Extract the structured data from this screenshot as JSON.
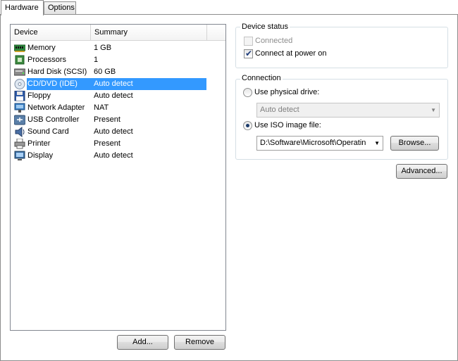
{
  "tabs": [
    {
      "label": "Hardware",
      "active": true
    },
    {
      "label": "Options",
      "active": false
    }
  ],
  "device_list": {
    "columns": {
      "device": "Device",
      "summary": "Summary"
    },
    "rows": [
      {
        "device": "Memory",
        "summary": "1 GB",
        "icon": "memory-icon"
      },
      {
        "device": "Processors",
        "summary": "1",
        "icon": "processor-icon"
      },
      {
        "device": "Hard Disk (SCSI)",
        "summary": "60 GB",
        "icon": "hard-disk-icon"
      },
      {
        "device": "CD/DVD (IDE)",
        "summary": "Auto detect",
        "icon": "cd-dvd-icon",
        "selected": true
      },
      {
        "device": "Floppy",
        "summary": "Auto detect",
        "icon": "floppy-icon"
      },
      {
        "device": "Network Adapter",
        "summary": "NAT",
        "icon": "network-adapter-icon"
      },
      {
        "device": "USB Controller",
        "summary": "Present",
        "icon": "usb-icon"
      },
      {
        "device": "Sound Card",
        "summary": "Auto detect",
        "icon": "sound-card-icon"
      },
      {
        "device": "Printer",
        "summary": "Present",
        "icon": "printer-icon"
      },
      {
        "device": "Display",
        "summary": "Auto detect",
        "icon": "display-icon"
      }
    ]
  },
  "buttons": {
    "add": "Add...",
    "remove": "Remove",
    "browse": "Browse...",
    "advanced": "Advanced..."
  },
  "device_status": {
    "title": "Device status",
    "connected": {
      "label": "Connected",
      "checked": false,
      "enabled": false
    },
    "connect_at_power_on": {
      "label": "Connect at power on",
      "checked": true,
      "enabled": true
    }
  },
  "connection": {
    "title": "Connection",
    "use_physical_drive": {
      "label": "Use physical drive:",
      "selected": false
    },
    "physical_drive_value": "Auto detect",
    "use_iso": {
      "label": "Use ISO image file:",
      "selected": true
    },
    "iso_value": "D:\\Software\\Microsoft\\Operatin"
  },
  "colors": {
    "selection": "#3399ff",
    "border": "#828790",
    "group_border": "#d5dfe5"
  }
}
